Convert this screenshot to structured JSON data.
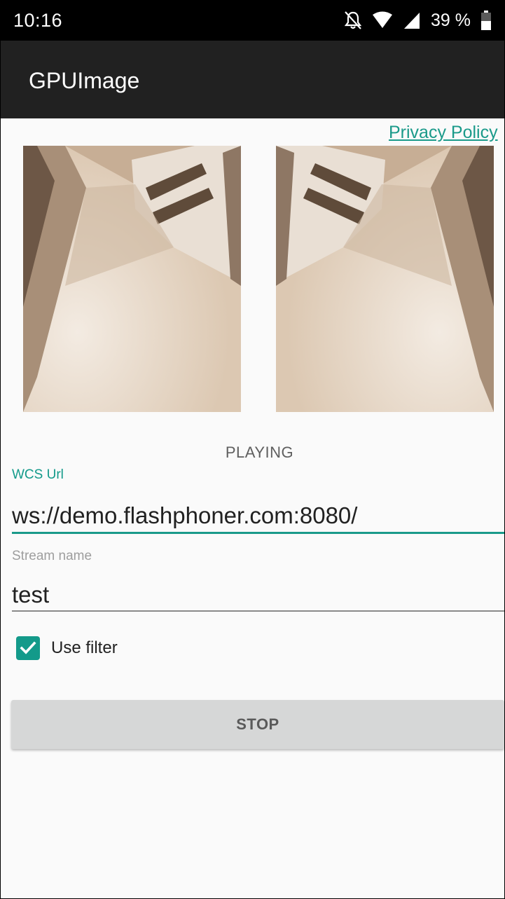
{
  "status_bar": {
    "time": "10:16",
    "battery": "39 %",
    "icons": [
      "notifications-off-icon",
      "wifi-icon",
      "signal-icon",
      "battery-icon"
    ]
  },
  "app_bar": {
    "title": "GPUImage"
  },
  "privacy_link": "Privacy Policy",
  "videos": {
    "local": "local-video-view",
    "remote": "remote-video-view"
  },
  "stream_status": "PLAYING",
  "wcs_url": {
    "label": "WCS Url",
    "value": "ws://demo.flashphoner.com:8080/"
  },
  "stream_name": {
    "label": "Stream name",
    "value": "test"
  },
  "use_filter": {
    "label": "Use filter",
    "checked": true
  },
  "stop_button": "STOP",
  "colors": {
    "accent": "#139a8a",
    "app_bar": "#212121",
    "status_bar": "#000000",
    "button": "#d6d7d7"
  }
}
